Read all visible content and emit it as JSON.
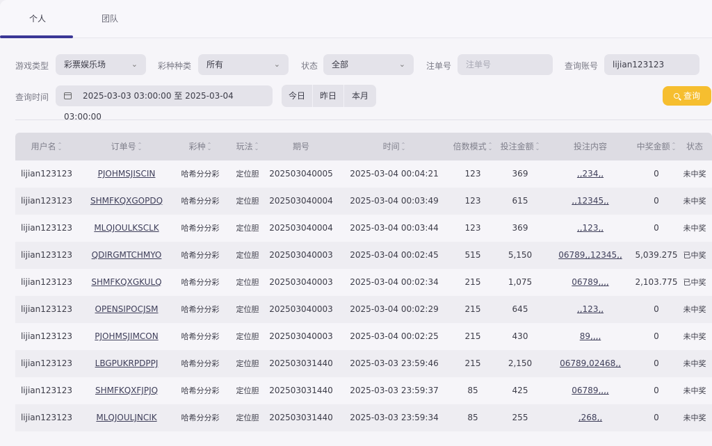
{
  "tabs": [
    "个人",
    "团队"
  ],
  "filters": {
    "game_type_label": "游戏类型",
    "game_type_value": "彩票娱乐场",
    "lottery_label": "彩种种类",
    "lottery_value": "所有",
    "status_label": "状态",
    "status_value": "全部",
    "order_label": "注单号",
    "order_placeholder": "注单号",
    "account_label": "查询账号",
    "account_value": "lijian123123",
    "time_label": "查询时间",
    "time_value": "2025-03-03 03:00:00 至 2025-03-04 03:00:00",
    "quick": [
      "今日",
      "昨日",
      "本月"
    ],
    "search_label": "查询"
  },
  "table": {
    "headers": [
      "用户名",
      "订单号",
      "彩种",
      "玩法",
      "期号",
      "时间",
      "倍数模式",
      "投注金额",
      "投注内容",
      "中奖金额",
      "状态"
    ],
    "rows": [
      [
        "lijian123123",
        "PJOHMSJISCIN",
        "哈希分分彩",
        "定位胆",
        "202503040005",
        "2025-03-04 00:04:21",
        "123",
        "369",
        ",,234,,",
        "0",
        "未中奖"
      ],
      [
        "lijian123123",
        "SHMFKQXGOPDQ",
        "哈希分分彩",
        "定位胆",
        "202503040004",
        "2025-03-04 00:03:49",
        "123",
        "615",
        ",,12345,,",
        "0",
        "未中奖"
      ],
      [
        "lijian123123",
        "MLQJOULKSCLK",
        "哈希分分彩",
        "定位胆",
        "202503040004",
        "2025-03-04 00:03:44",
        "123",
        "369",
        ",,123,,",
        "0",
        "未中奖"
      ],
      [
        "lijian123123",
        "QDIRGMTCHMYO",
        "哈希分分彩",
        "定位胆",
        "202503040003",
        "2025-03-04 00:02:45",
        "515",
        "5,150",
        "06789,,12345,,",
        "5,039.275",
        "已中奖"
      ],
      [
        "lijian123123",
        "SHMFKQXGKULQ",
        "哈希分分彩",
        "定位胆",
        "202503040003",
        "2025-03-04 00:02:34",
        "215",
        "1,075",
        "06789,,,,",
        "2,103.775",
        "已中奖"
      ],
      [
        "lijian123123",
        "OPENSIPOCJSM",
        "哈希分分彩",
        "定位胆",
        "202503040003",
        "2025-03-04 00:02:29",
        "215",
        "645",
        ",,123,,",
        "0",
        "未中奖"
      ],
      [
        "lijian123123",
        "PJOHMSJIMCON",
        "哈希分分彩",
        "定位胆",
        "202503040003",
        "2025-03-04 00:02:25",
        "215",
        "430",
        "89,,,,",
        "0",
        "未中奖"
      ],
      [
        "lijian123123",
        "LBGPUKRPDPPJ",
        "哈希分分彩",
        "定位胆",
        "202503031440",
        "2025-03-03 23:59:46",
        "215",
        "2,150",
        "06789,02468,,",
        "0",
        "未中奖"
      ],
      [
        "lijian123123",
        "SHMFKQXFJPJQ",
        "哈希分分彩",
        "定位胆",
        "202503031440",
        "2025-03-03 23:59:37",
        "85",
        "425",
        "06789,,,,",
        "0",
        "未中奖"
      ],
      [
        "lijian123123",
        "MLQJOULJNCIK",
        "哈希分分彩",
        "定位胆",
        "202503031440",
        "2025-03-03 23:59:34",
        "85",
        "255",
        ",268,,",
        "0",
        "未中奖"
      ]
    ]
  }
}
